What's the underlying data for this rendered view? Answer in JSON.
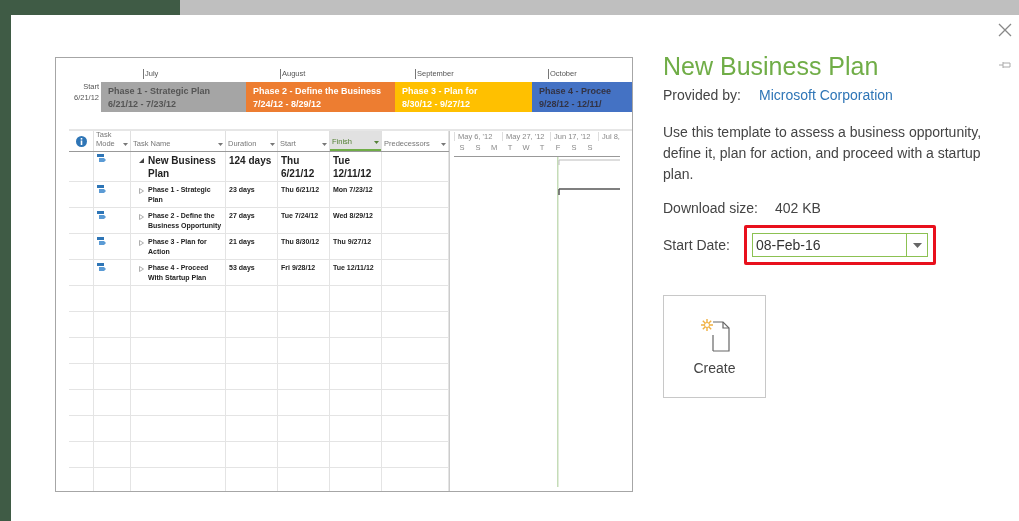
{
  "preview": {
    "timeline": {
      "start_label": "Start",
      "start_date": "6/21/12",
      "months": [
        "July",
        "August",
        "September",
        "October"
      ],
      "phases": [
        {
          "name": "Phase 1 - Strategic Plan",
          "dates": "6/21/12 - 7/23/12",
          "color": "#a5a5a5"
        },
        {
          "name": "Phase 2 - Define the Business",
          "dates": "7/24/12 - 8/29/12",
          "color": "#ed7d31"
        },
        {
          "name": "Phase 3 - Plan for",
          "dates": "8/30/12 - 9/27/12",
          "color": "#ffc000"
        },
        {
          "name": "Phase 4 - Procee",
          "dates": "9/28/12 - 12/11/",
          "color": "#4472c4"
        }
      ]
    },
    "columns": [
      {
        "label": "Task Mode",
        "selected": false
      },
      {
        "label": "Task Name",
        "selected": false
      },
      {
        "label": "Duration",
        "selected": false
      },
      {
        "label": "Start",
        "selected": false
      },
      {
        "label": "Finish",
        "selected": true
      },
      {
        "label": "Predecessors",
        "selected": false
      }
    ],
    "rows": [
      {
        "kind": "summary",
        "expanded": true,
        "task_name": "New Business Plan",
        "duration": "124 days",
        "start": "Thu 6/21/12",
        "finish": "Tue 12/11/12"
      },
      {
        "kind": "task",
        "expanded": false,
        "task_name": "Phase 1 - Strategic Plan",
        "duration": "23 days",
        "start": "Thu 6/21/12",
        "finish": "Mon 7/23/12"
      },
      {
        "kind": "task",
        "expanded": false,
        "task_name": "Phase 2 - Define the Business Opportunity",
        "duration": "27 days",
        "start": "Tue 7/24/12",
        "finish": "Wed 8/29/12"
      },
      {
        "kind": "task",
        "expanded": false,
        "task_name": "Phase 3 - Plan for Action",
        "duration": "21 days",
        "start": "Thu 8/30/12",
        "finish": "Thu 9/27/12"
      },
      {
        "kind": "task",
        "expanded": false,
        "task_name": "Phase 4 - Proceed With Startup Plan",
        "duration": "53 days",
        "start": "Fri 9/28/12",
        "finish": "Tue 12/11/12"
      }
    ],
    "gantt": {
      "weeks": [
        "May 6, '12",
        "May 27, '12",
        "Jun 17, '12",
        "Jul 8,"
      ],
      "days": [
        "S",
        "S",
        "M",
        "T",
        "W",
        "T",
        "F",
        "S",
        "S"
      ]
    }
  },
  "details": {
    "title": "New Business Plan",
    "provided_by_label": "Provided by:",
    "provider": "Microsoft Corporation",
    "description": "Use this template to assess a business opportunity, define it, plan for action, and proceed with a startup plan.",
    "download_size_label": "Download size:",
    "download_size": "402 KB",
    "start_date_label": "Start Date:",
    "start_date": "08-Feb-16",
    "start_date_highlighted": true,
    "create_button": "Create"
  }
}
